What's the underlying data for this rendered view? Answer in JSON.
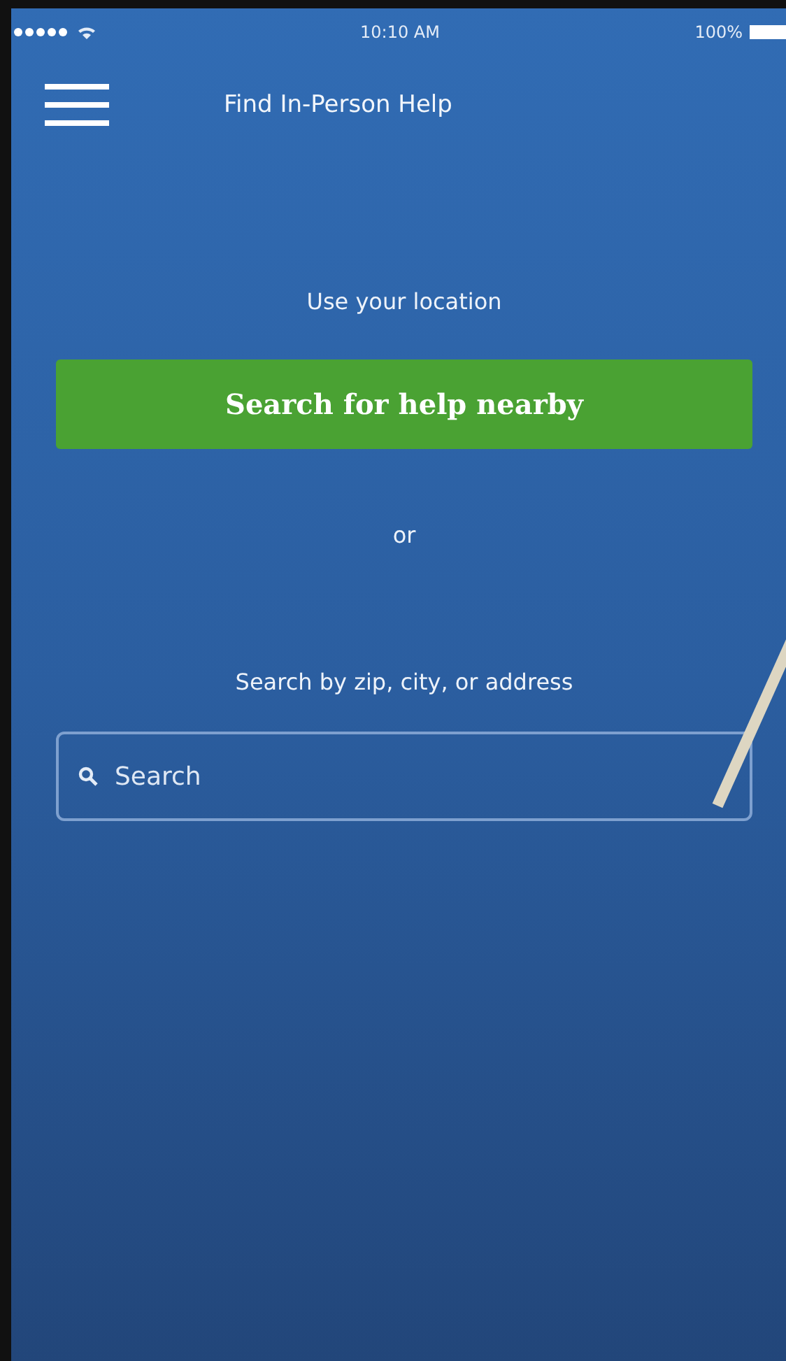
{
  "status_bar": {
    "time": "10:10 AM",
    "battery": "100%"
  },
  "nav": {
    "title": "Find In-Person Help"
  },
  "location_label": "Use your location",
  "nearby_button": "Search for help nearby",
  "divider_text": "or",
  "search_label": "Search by zip, city, or address",
  "search": {
    "placeholder": "Search"
  }
}
